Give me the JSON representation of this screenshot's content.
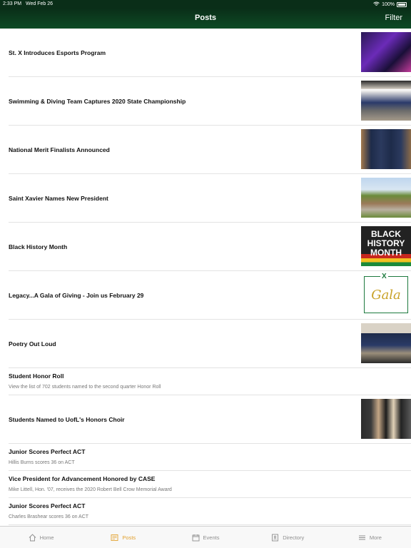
{
  "status_bar": {
    "time": "2:33 PM",
    "date": "Wed Feb 26",
    "battery": "100%"
  },
  "header": {
    "title": "Posts",
    "filter_label": "Filter"
  },
  "posts": [
    {
      "title": "St. X Introduces Esports Program"
    },
    {
      "title": "Swimming & Diving Team Captures 2020 State Championship"
    },
    {
      "title": "National Merit Finalists Announced"
    },
    {
      "title": "Saint Xavier Names New President"
    },
    {
      "title": "Black History Month",
      "thumb_text": [
        "BLACK",
        "HISTORY",
        "MONTH"
      ]
    },
    {
      "title": "Legacy...A Gala of Giving - Join us February 29",
      "thumb_text": {
        "mark": "X",
        "word": "Gala"
      }
    },
    {
      "title": "Poetry Out Loud"
    },
    {
      "title": "Student Honor Roll",
      "subtitle": "View the list of 702 students named to the second quarter Honor Roll"
    },
    {
      "title": "Students Named to UofL's Honors Choir"
    },
    {
      "title": "Junior Scores Perfect ACT",
      "subtitle": "Hillis Burns scores 36 on ACT"
    },
    {
      "title": "Vice President for Advancement Honored by CASE",
      "subtitle": "Mike Littell, Hon. '07, receives the 2020 Robert Bell Crow Memorial Award"
    },
    {
      "title": "Junior Scores Perfect ACT",
      "subtitle": "Charles Brashear scores 36 on ACT"
    }
  ],
  "tabs": [
    {
      "label": "Home",
      "icon": "home-icon"
    },
    {
      "label": "Posts",
      "icon": "posts-icon",
      "active": true
    },
    {
      "label": "Events",
      "icon": "calendar-icon"
    },
    {
      "label": "Directory",
      "icon": "directory-icon"
    },
    {
      "label": "More",
      "icon": "menu-icon"
    }
  ],
  "colors": {
    "header": "#0d4a25",
    "active_tab": "#e2a12f",
    "inactive_tab": "#8e8e8e"
  }
}
